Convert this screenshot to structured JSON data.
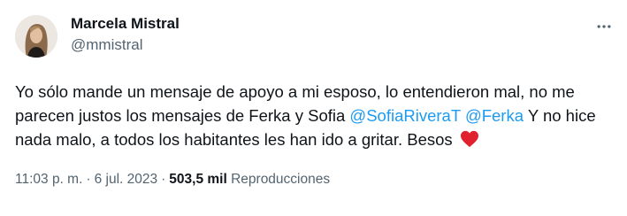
{
  "author": {
    "display_name": "Marcela Mistral",
    "handle": "@mmistral"
  },
  "tweet": {
    "text_part1": "Yo sólo mande un mensaje de apoyo a mi esposo, lo entendieron mal, no me parecen justos los mensajes de Ferka y Sofia ",
    "mention1": "@SofiaRiveraT",
    "mention2": "@Ferka",
    "text_part2": " Y no hice nada malo, a todos los habitantes les han ido a gritar. Besos ",
    "emoji": "heart-icon"
  },
  "meta": {
    "time": "11:03 p. m.",
    "separator": "·",
    "date": "6 jul. 2023",
    "views_count": "503,5 mil",
    "views_label": "Reproducciones"
  },
  "colors": {
    "link": "#1d9bf0",
    "secondary_text": "#536471",
    "primary_text": "#0f1419",
    "heart": "#f91880"
  }
}
